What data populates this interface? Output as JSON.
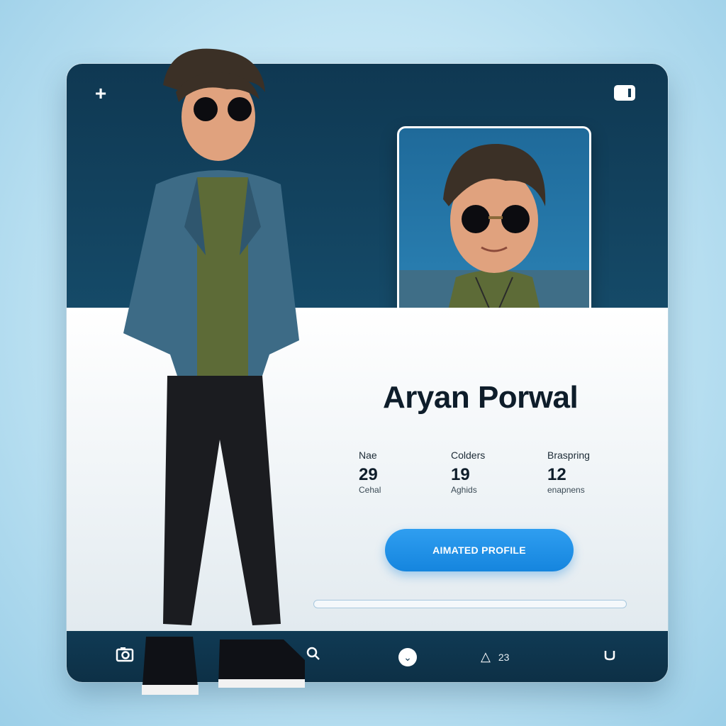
{
  "profile": {
    "name": "Aryan Porwal"
  },
  "stats": [
    {
      "label": "Nae",
      "value": "29",
      "sub": "Cehal"
    },
    {
      "label": "Colders",
      "value": "19",
      "sub": "Aghids"
    },
    {
      "label": "Braspring",
      "value": "12",
      "sub": "enapnens"
    }
  ],
  "cta": {
    "label": "AIMATED PROFILE"
  },
  "progress": {
    "value_fraction": 0.0
  },
  "nav": {
    "count": "23"
  },
  "colors": {
    "header": "#0f3852",
    "accent": "#1585de",
    "body": "#eef3f6"
  },
  "icons": {
    "top_left": "plus-icon",
    "top_right": "window-icon",
    "nav": [
      "camera-icon",
      "search-icon",
      "chevron-down-circle-icon",
      "bell-icon",
      "refresh-icon"
    ]
  }
}
